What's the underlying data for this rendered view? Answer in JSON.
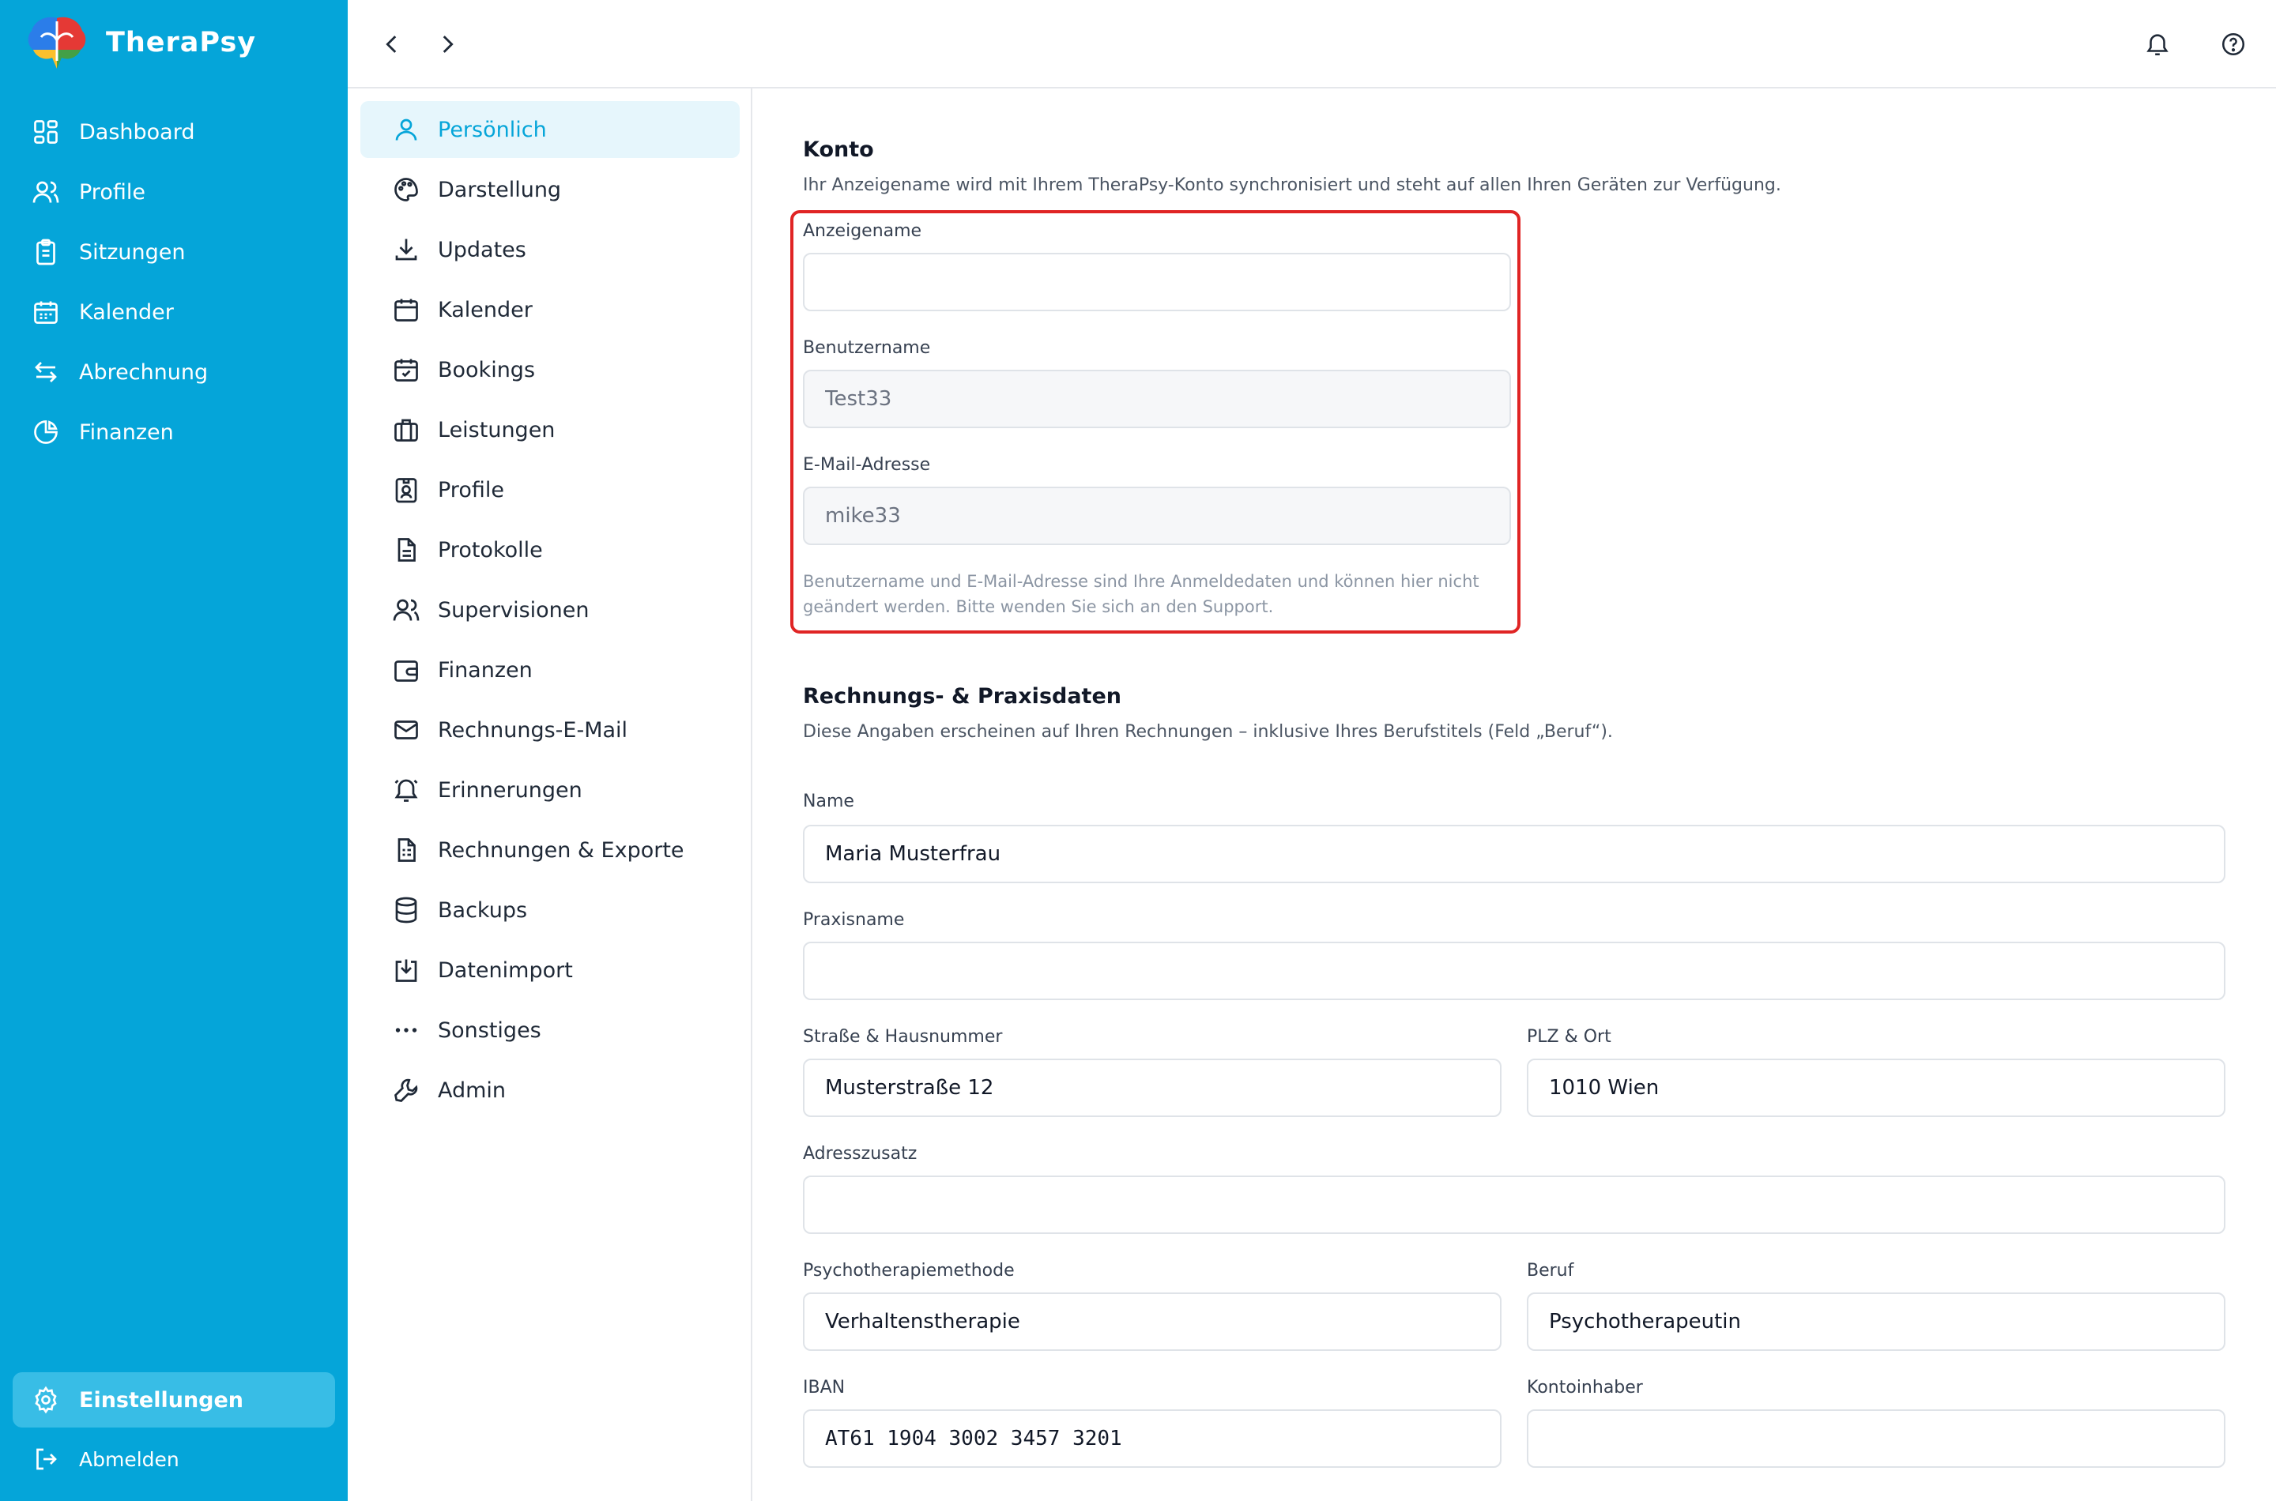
{
  "app": {
    "name": "TheraPsy"
  },
  "colors": {
    "brand": "#05a5d9",
    "active_nav": "#38bde6",
    "highlight": "#e02424"
  },
  "sidebar": {
    "items": [
      {
        "label": "Dashboard",
        "icon": "dashboard-icon"
      },
      {
        "label": "Profile",
        "icon": "users-icon"
      },
      {
        "label": "Sitzungen",
        "icon": "clipboard-icon"
      },
      {
        "label": "Kalender",
        "icon": "calendar-icon"
      },
      {
        "label": "Abrechnung",
        "icon": "arrows-swap-icon"
      },
      {
        "label": "Finanzen",
        "icon": "pie-chart-icon"
      }
    ],
    "settings_label": "Einstellungen",
    "logout_label": "Abmelden"
  },
  "topbar": {
    "back": "chevron-left-icon",
    "forward": "chevron-right-icon",
    "notifications": "bell-icon",
    "help": "help-icon"
  },
  "settings_menu": {
    "items": [
      {
        "label": "Persönlich",
        "icon": "user-icon",
        "active": true
      },
      {
        "label": "Darstellung",
        "icon": "palette-icon"
      },
      {
        "label": "Updates",
        "icon": "download-icon"
      },
      {
        "label": "Kalender",
        "icon": "calendar-icon"
      },
      {
        "label": "Bookings",
        "icon": "calendar-check-icon"
      },
      {
        "label": "Leistungen",
        "icon": "briefcase-icon"
      },
      {
        "label": "Profile",
        "icon": "id-badge-icon"
      },
      {
        "label": "Protokolle",
        "icon": "document-icon"
      },
      {
        "label": "Supervisionen",
        "icon": "users-icon"
      },
      {
        "label": "Finanzen",
        "icon": "wallet-icon"
      },
      {
        "label": "Rechnungs-E-Mail",
        "icon": "mail-icon"
      },
      {
        "label": "Erinnerungen",
        "icon": "bell-ring-icon"
      },
      {
        "label": "Rechnungen & Exporte",
        "icon": "invoice-icon"
      },
      {
        "label": "Backups",
        "icon": "database-icon"
      },
      {
        "label": "Datenimport",
        "icon": "import-icon"
      },
      {
        "label": "Sonstiges",
        "icon": "more-icon"
      },
      {
        "label": "Admin",
        "icon": "wrench-icon"
      }
    ]
  },
  "konto": {
    "title": "Konto",
    "description": "Ihr Anzeigename wird mit Ihrem TheraPsy-Konto synchronisiert und steht auf allen Ihren Geräten zur Verfügung.",
    "display_name": {
      "label": "Anzeigename",
      "value": ""
    },
    "username": {
      "label": "Benutzername",
      "value": "Test33"
    },
    "email": {
      "label": "E-Mail-Adresse",
      "value": "mike33"
    },
    "hint": "Benutzername und E-Mail-Adresse sind Ihre Anmeldedaten und können hier nicht geändert werden. Bitte wenden Sie sich an den Support."
  },
  "billing": {
    "title": "Rechnungs- & Praxisdaten",
    "description": "Diese Angaben erscheinen auf Ihren Rechnungen – inklusive Ihres Berufstitels (Feld „Beruf“).",
    "name": {
      "label": "Name",
      "value": "Maria Musterfrau"
    },
    "practice": {
      "label": "Praxisname",
      "value": ""
    },
    "street": {
      "label": "Straße & Hausnummer",
      "value": "Musterstraße 12"
    },
    "city": {
      "label": "PLZ & Ort",
      "value": "1010 Wien"
    },
    "address_extra": {
      "label": "Adresszusatz",
      "value": ""
    },
    "method": {
      "label": "Psychotherapiemethode",
      "value": "Verhaltenstherapie"
    },
    "profession": {
      "label": "Beruf",
      "value": "Psychotherapeutin"
    },
    "iban": {
      "label": "IBAN",
      "value": "AT61 1904 3002 3457 3201"
    },
    "account_holder": {
      "label": "Kontoinhaber",
      "value": ""
    }
  }
}
